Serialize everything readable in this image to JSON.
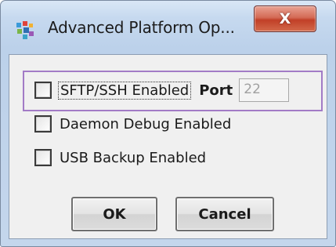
{
  "window": {
    "title": "Advanced Platform Op...",
    "close_symbol": "X",
    "app_icon": "colored-squares-icon"
  },
  "options": [
    {
      "label": "SFTP/SSH Enabled",
      "checked": false
    },
    {
      "label": "Daemon Debug Enabled",
      "checked": false
    },
    {
      "label": "USB Backup Enabled",
      "checked": false
    }
  ],
  "port": {
    "label": "Port",
    "value": "22"
  },
  "buttons": {
    "ok_label": "OK",
    "cancel_label": "Cancel"
  },
  "colors": {
    "highlight": "#a27bc6",
    "close_button": "#c13f27",
    "title_bar": "#c6d9ef"
  }
}
